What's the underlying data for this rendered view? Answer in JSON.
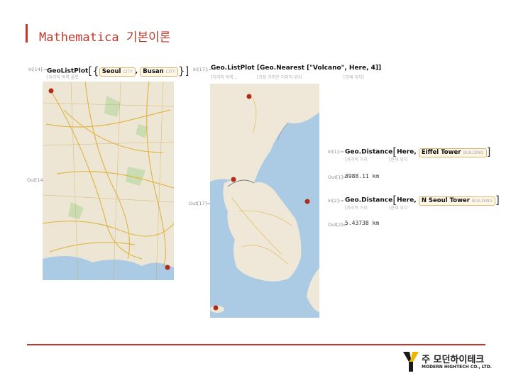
{
  "slide": {
    "title": "Mathematica 기본이론"
  },
  "cell1": {
    "in_label": "In[14]:=",
    "code_fn": "GeoListPlot",
    "entity1": {
      "name": "Seoul",
      "type": "CITY"
    },
    "entity2": {
      "name": "Busan",
      "type": "CITY"
    },
    "hint": "[지리적 목록 플롯",
    "out_label": "Out[14]="
  },
  "cell2": {
    "in_label": "In[17]:=",
    "code": "Geo.ListPlot [Geo.Nearest [\"Volcano\", Here, 4]]",
    "hint1": "[지리적 목록...",
    "hint2": "[가장 가까운 지리적 위치",
    "hint3": "[현재 위치]",
    "out_label": "Out[17]="
  },
  "cell3": {
    "in_label": "In[1]:=",
    "code": "Geo.Distance",
    "arg": "Here,",
    "entity": {
      "name": "Eiffel Tower",
      "type": "BUILDING"
    },
    "hint1": "[지리적 거리",
    "hint2": "[현재 위치",
    "out_label": "Out[1]=",
    "result": "8988.11 km"
  },
  "cell4": {
    "in_label": "In[2]:=",
    "code": "Geo.Distance",
    "arg": "Here,",
    "entity": {
      "name": "N Seoul Tower",
      "type": "BUILDING"
    },
    "hint1": "[지리적 거리",
    "hint2": "[현재 위치",
    "out_label": "Out[2]=",
    "result": "5.43738 km"
  },
  "footer": {
    "logo_ko": "주 모던하이테크",
    "logo_en": "MODERN HIGHTECH CO., LTD."
  },
  "colors": {
    "accent": "#c0392b",
    "sea": "#aacbe3",
    "land": "#efe8d8",
    "marker": "#b22c1a"
  }
}
